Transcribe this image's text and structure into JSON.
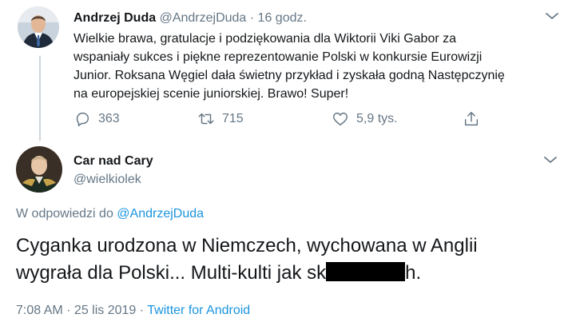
{
  "colors": {
    "text": "#14171a",
    "secondary": "#657786",
    "link": "#1b95e0",
    "thread_line": "#ccd6dd"
  },
  "tweet1": {
    "name": "Andrzej Duda",
    "handle": "@AndrzejDuda",
    "separator": " · ",
    "time": "16 godz.",
    "avatar_icon": "portrait-avatar",
    "lines": [
      "Wielkie brawa, gratulacje i podziękowania dla Wiktorii Viki Gabor za",
      "wspaniały sukces i piękne reprezentowanie Polski w konkursie Eurowizji",
      "Junior. Roksana Węgiel dała świetny przykład i zyskała godną Następczynię",
      "na europejskiej scenie juniorskiej. Brawo! Super!"
    ],
    "replies": "363",
    "retweets": "715",
    "likes": "5,9 tys."
  },
  "tweet2": {
    "name": "Car nad Cary",
    "handle": "@wielkiolek",
    "avatar_icon": "portrait-avatar",
    "reply_prefix": "W odpowiedzi do ",
    "reply_mention": "@AndrzejDuda",
    "line1": "Cyganka urodzona w Niemczech, wychowana w Anglii",
    "line2_start": "wygrała dla Polski... Multi-kulti jak sk",
    "line2_end": "h.",
    "time": "7:08 AM",
    "separator": " · ",
    "date": "25 lis 2019",
    "source": "Twitter for Android"
  }
}
